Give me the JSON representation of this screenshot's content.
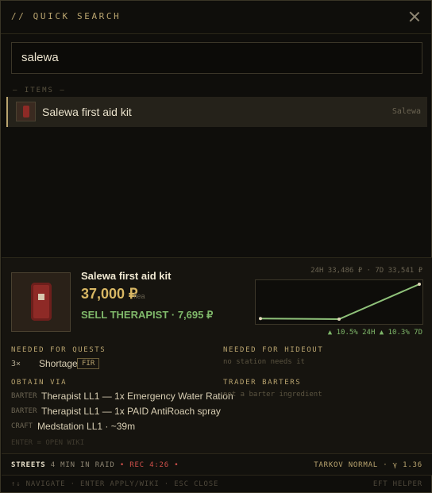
{
  "header": {
    "title": "// QUICK SEARCH"
  },
  "search": {
    "value": "salewa"
  },
  "results": {
    "section_label": "– ITEMS –",
    "items": [
      {
        "name": "Salewa first aid kit",
        "source": "Salewa"
      }
    ]
  },
  "detail": {
    "name": "Salewa first aid kit",
    "price": "37,000 ₽",
    "price_source": "flea",
    "sell": "SELL THERAPIST · 7,695 ₽",
    "trend_header": "24H 33,486 ₽ · 7D 33,541 ₽",
    "trend_change": "▲ 10.5% 24H  ▲ 10.3% 7D",
    "chart_data": {
      "type": "line",
      "series": [
        {
          "values": [
            33541,
            33486,
            37000
          ]
        }
      ],
      "color": "#8fc27a"
    },
    "quests": {
      "heading": "NEEDED FOR QUESTS",
      "entries": [
        {
          "count": "3×",
          "quest": "Shortage",
          "badge": "FIR"
        }
      ]
    },
    "hideout": {
      "heading": "NEEDED FOR HIDEOUT",
      "text": "no station needs it"
    },
    "obtain": {
      "heading": "OBTAIN VIA",
      "entries": [
        {
          "kind": "BARTER",
          "text": "Therapist LL1 — 1x Emergency Water Ration"
        },
        {
          "kind": "BARTER",
          "text": "Therapist LL1 — 1x PAID AntiRoach spray"
        },
        {
          "kind": "CRAFT",
          "text": "Medstation LL1 · ~39m"
        }
      ]
    },
    "barters": {
      "heading": "TRADER BARTERS",
      "text": "not a barter ingredient"
    },
    "wiki_hint": "ENTER = OPEN WIKI"
  },
  "status": {
    "map": "STREETS",
    "raid": "4 MIN IN RAID",
    "rec": "REC 4:26",
    "right": "TARKOV NORMAL · γ 1.36"
  },
  "footer": {
    "left": "↑↓ NAVIGATE · ENTER APPLY/WIKI · ESC CLOSE",
    "right": "EFT HELPER"
  }
}
